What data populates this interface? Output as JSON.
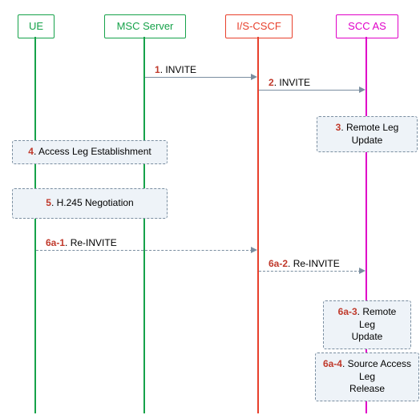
{
  "participants": {
    "ue": {
      "label": "UE",
      "color": "#16a24a"
    },
    "msc": {
      "label": "MSC Server",
      "color": "#16a24a"
    },
    "cscf": {
      "label": "I/S-CSCF",
      "color": "#e8402c"
    },
    "scc": {
      "label": "SCC AS",
      "color": "#e000c8"
    }
  },
  "messages": {
    "m1": {
      "num": "1",
      "text": ". INVITE"
    },
    "m2": {
      "num": "2",
      "text": ". INVITE"
    },
    "m6a1": {
      "num": "6a-1",
      "text": ". Re-INVITE"
    },
    "m6a2": {
      "num": "6a-2",
      "text": ". Re-INVITE"
    }
  },
  "notes": {
    "n3": {
      "num": "3",
      "text": ". Remote Leg Update"
    },
    "n4": {
      "num": "4",
      "text": ". Access Leg Establishment"
    },
    "n5": {
      "num": "5",
      "text": ". H.245 Negotiation"
    },
    "n6a3": {
      "num": "6a-3",
      "text": ". Remote Leg",
      "text2": "Update"
    },
    "n6a4": {
      "num": "6a-4",
      "text": ". Source Access Leg",
      "text2": "Release"
    }
  }
}
